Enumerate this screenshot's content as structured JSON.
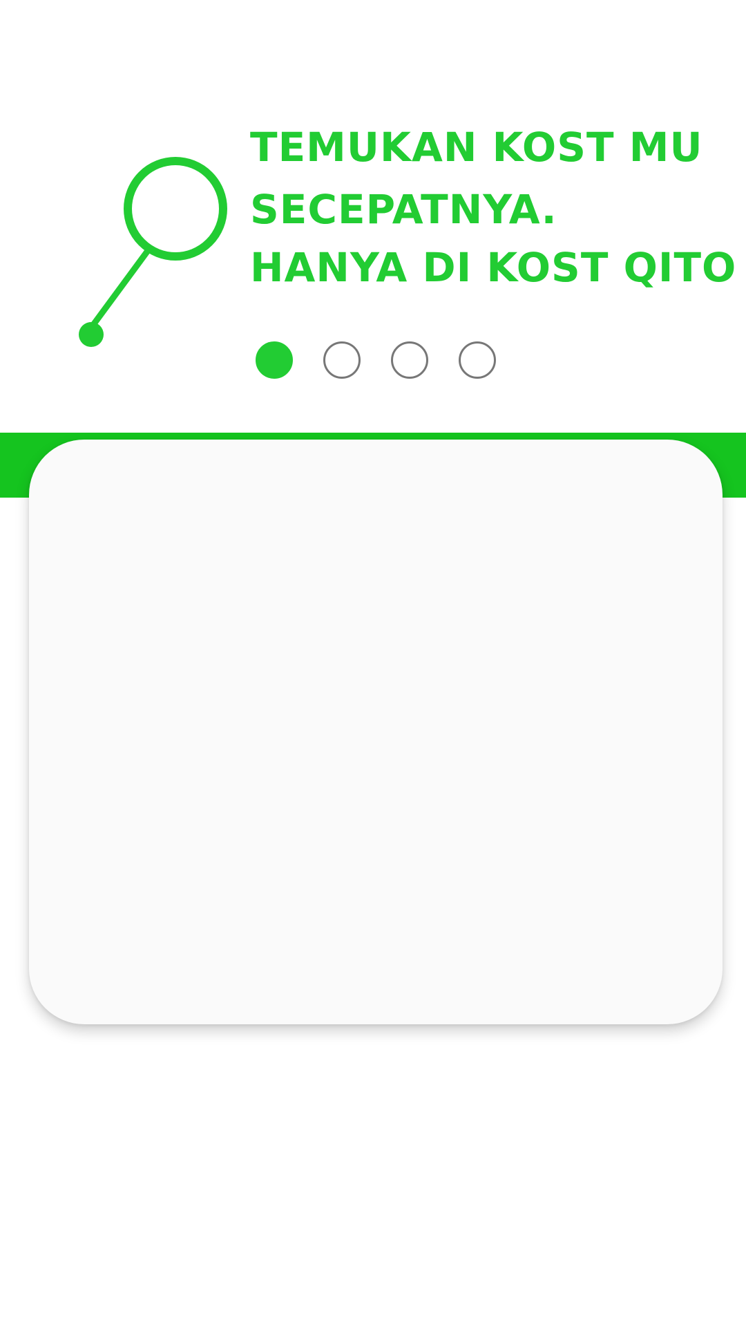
{
  "colors": {
    "status_bar": "#2ef53a",
    "accent": "#22cc33",
    "band": "#15c41f",
    "dot_inactive_border": "#777777",
    "card_background": "#fafafa"
  },
  "onboarding": {
    "icon": "magnifier-icon",
    "headline": {
      "line1": "TEMUKAN KOST MU",
      "line2": "SECEPATNYA.",
      "line3": "HANYA DI KOST QITO"
    },
    "pager": {
      "total": 4,
      "active_index": 0
    }
  }
}
